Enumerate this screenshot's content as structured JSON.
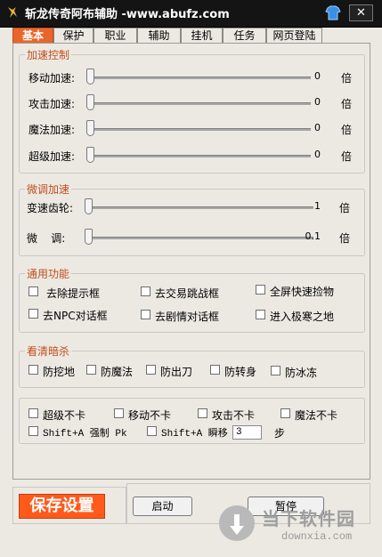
{
  "window": {
    "title": "斩龙传奇阿布辅助 -www.abufz.com",
    "close_label": "✕"
  },
  "tabs": [
    {
      "label": "基本",
      "active": true
    },
    {
      "label": "保护"
    },
    {
      "label": "职业"
    },
    {
      "label": "辅助"
    },
    {
      "label": "挂机"
    },
    {
      "label": "任务"
    },
    {
      "label": "网页登陆"
    }
  ],
  "speed": {
    "title": "加速控制",
    "rows": [
      {
        "label": "移动加速:",
        "value": "0",
        "unit": "倍",
        "level": 0
      },
      {
        "label": "攻击加速:",
        "value": "0",
        "unit": "倍",
        "level": 0
      },
      {
        "label": "魔法加速:",
        "value": "0",
        "unit": "倍",
        "level": 0
      },
      {
        "label": "超级加速:",
        "value": "0",
        "unit": "倍",
        "level": 0
      }
    ]
  },
  "fine": {
    "title": "微调加速",
    "rows": [
      {
        "label": "变速齿轮:",
        "value": "1",
        "unit": "倍",
        "level": 0
      },
      {
        "label": "微    调:",
        "value": "0.1",
        "unit": "倍",
        "level": 0
      }
    ]
  },
  "general": {
    "title": "通用功能",
    "items": [
      "去除提示框",
      "去交易跳战框",
      "全屏快速捡物",
      "去NPC对话框",
      "去剧情对话框",
      "进入极寒之地"
    ]
  },
  "clear": {
    "title": "看清暗杀",
    "items": [
      "防挖地",
      "防魔法",
      "防出刀",
      "防转身",
      "防冰冻"
    ]
  },
  "misc": {
    "items": [
      "超级不卡",
      "移动不卡",
      "攻击不卡",
      "魔法不卡"
    ],
    "pk_label": "Shift+A 强制 Pk",
    "teleport_label": "Shift+A 瞬移",
    "teleport_value": "3",
    "teleport_unit": "步"
  },
  "buttons": {
    "save": "保存设置",
    "start": "启动",
    "pause": "暂停"
  },
  "watermark": {
    "brand": "当下软件园",
    "url": "downxia.com"
  }
}
